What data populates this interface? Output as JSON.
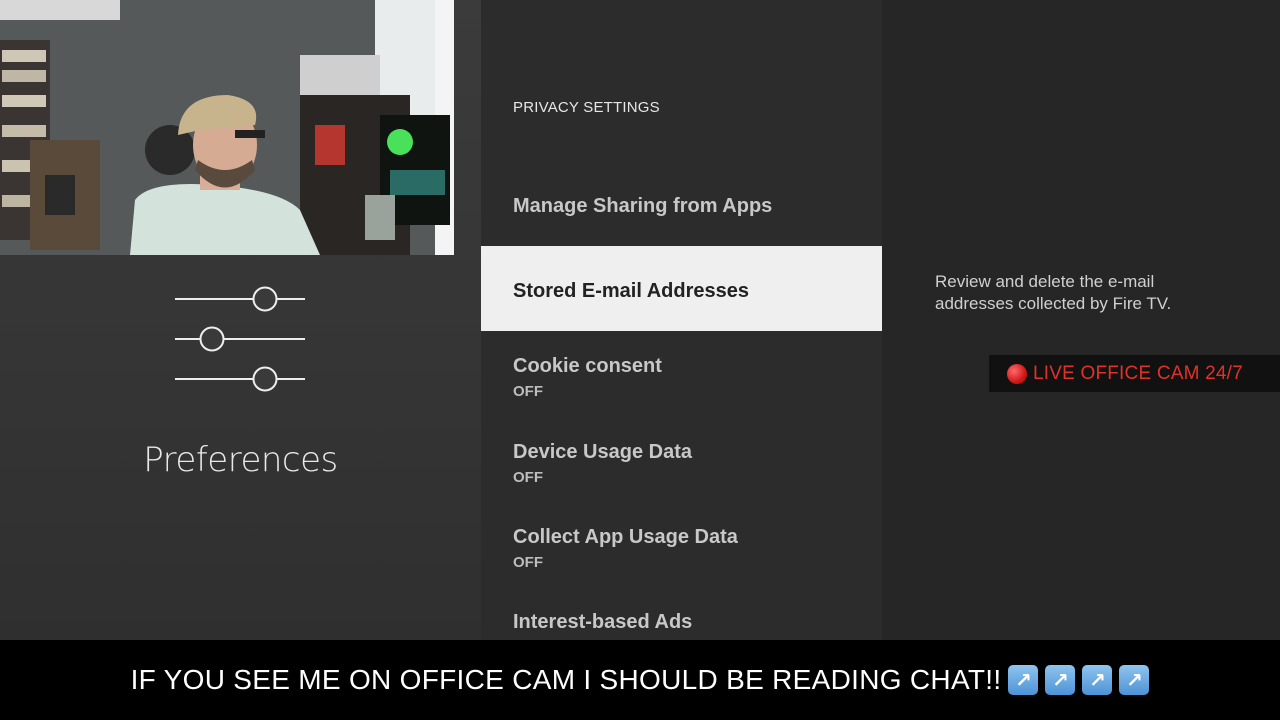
{
  "left": {
    "title": "Preferences",
    "icon": "sliders-icon"
  },
  "menu": {
    "header": "PRIVACY SETTINGS",
    "items": [
      {
        "label": "Manage Sharing from Apps",
        "sub": ""
      },
      {
        "label": "Stored E-mail Addresses",
        "sub": "",
        "selected": true
      },
      {
        "label": "Cookie consent",
        "sub": "OFF"
      },
      {
        "label": "Device Usage Data",
        "sub": "OFF"
      },
      {
        "label": "Collect App Usage Data",
        "sub": "OFF"
      },
      {
        "label": "Interest-based Ads",
        "sub": ""
      }
    ]
  },
  "detail": {
    "description": "Review and delete the e-mail addresses collected by Fire TV."
  },
  "overlay": {
    "live_badge": "LIVE OFFICE CAM 24/7",
    "banner": "IF YOU SEE ME ON OFFICE CAM I SHOULD BE READING CHAT!!",
    "arrow_icons": [
      "arrow-up-right-icon",
      "arrow-up-right-icon",
      "arrow-up-right-icon",
      "arrow-up-right-icon"
    ]
  },
  "colors": {
    "selected_bg": "#efefef",
    "live_red": "#e0312b"
  }
}
